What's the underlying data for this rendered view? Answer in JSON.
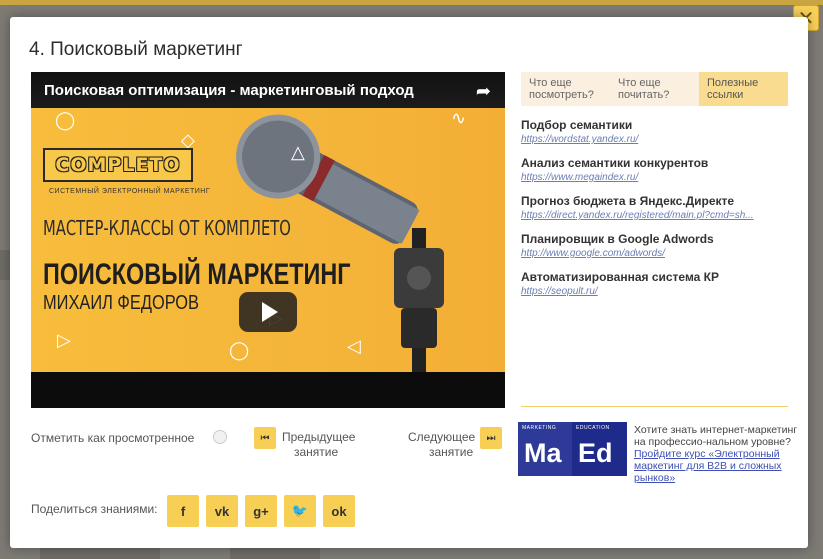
{
  "modal": {
    "title": "4. Поисковый маркетинг",
    "close_label": "✕"
  },
  "video": {
    "title": "Поисковая оптимизация - маркетинговый подход",
    "logo": "COMPLETO",
    "logo_sub": "СИСТЕМНЫЙ ЭЛЕКТРОННЫЙ МАРКЕТИНГ",
    "line1": "МАСТЕР-КЛАССЫ ОТ КОМПЛЕТО",
    "line2": "ПОИСКОВЫЙ МАРКЕТИНГ",
    "line3": "МИХАИЛ ФЕДОРОВ"
  },
  "tabs": [
    {
      "label": "Что еще посмотреть?",
      "active": false
    },
    {
      "label": "Что еще почитать?",
      "active": false
    },
    {
      "label": "Полезные ссылки",
      "active": true
    }
  ],
  "links": [
    {
      "title": "Подбор семантики",
      "url": "https://wordstat.yandex.ru/"
    },
    {
      "title": "Анализ семантики конкурентов",
      "url": "https://www.megaindex.ru/"
    },
    {
      "title": "Прогноз бюджета в Яндекс.Директе",
      "url": "https://direct.yandex.ru/registered/main.pl?cmd=sh..."
    },
    {
      "title": "Планировщик в Google Adwords",
      "url": "http://www.google.com/adwords/"
    },
    {
      "title": "Автоматизированная система КР",
      "url": "https://seopult.ru/"
    }
  ],
  "controls": {
    "mark_watched": "Отметить как просмотренное",
    "prev_line1": "Предыдущее",
    "prev_line2": "занятие",
    "next_line1": "Следующее",
    "next_line2": "занятие"
  },
  "promo": {
    "ma": "Ma",
    "ed": "Ed",
    "marketing": "MARKETING",
    "education": "EDUCATION",
    "text": "Хотите знать интернет-маркетинг на профессио-нальном уровне?",
    "link": "Пройдите курс «Электронный маркетинг для B2B и сложных рынков»"
  },
  "share": {
    "label": "Поделиться знаниями:",
    "networks": [
      {
        "icon": "facebook-icon",
        "glyph": "f"
      },
      {
        "icon": "vk-icon",
        "glyph": "vk"
      },
      {
        "icon": "google-plus-icon",
        "glyph": "g+"
      },
      {
        "icon": "twitter-icon",
        "glyph": "🐦"
      },
      {
        "icon": "odnoklassniki-icon",
        "glyph": "ok"
      }
    ]
  },
  "colors": {
    "accent": "#f8cf55",
    "link": "#6a7eb3",
    "tab_bg": "#fbefe0"
  }
}
